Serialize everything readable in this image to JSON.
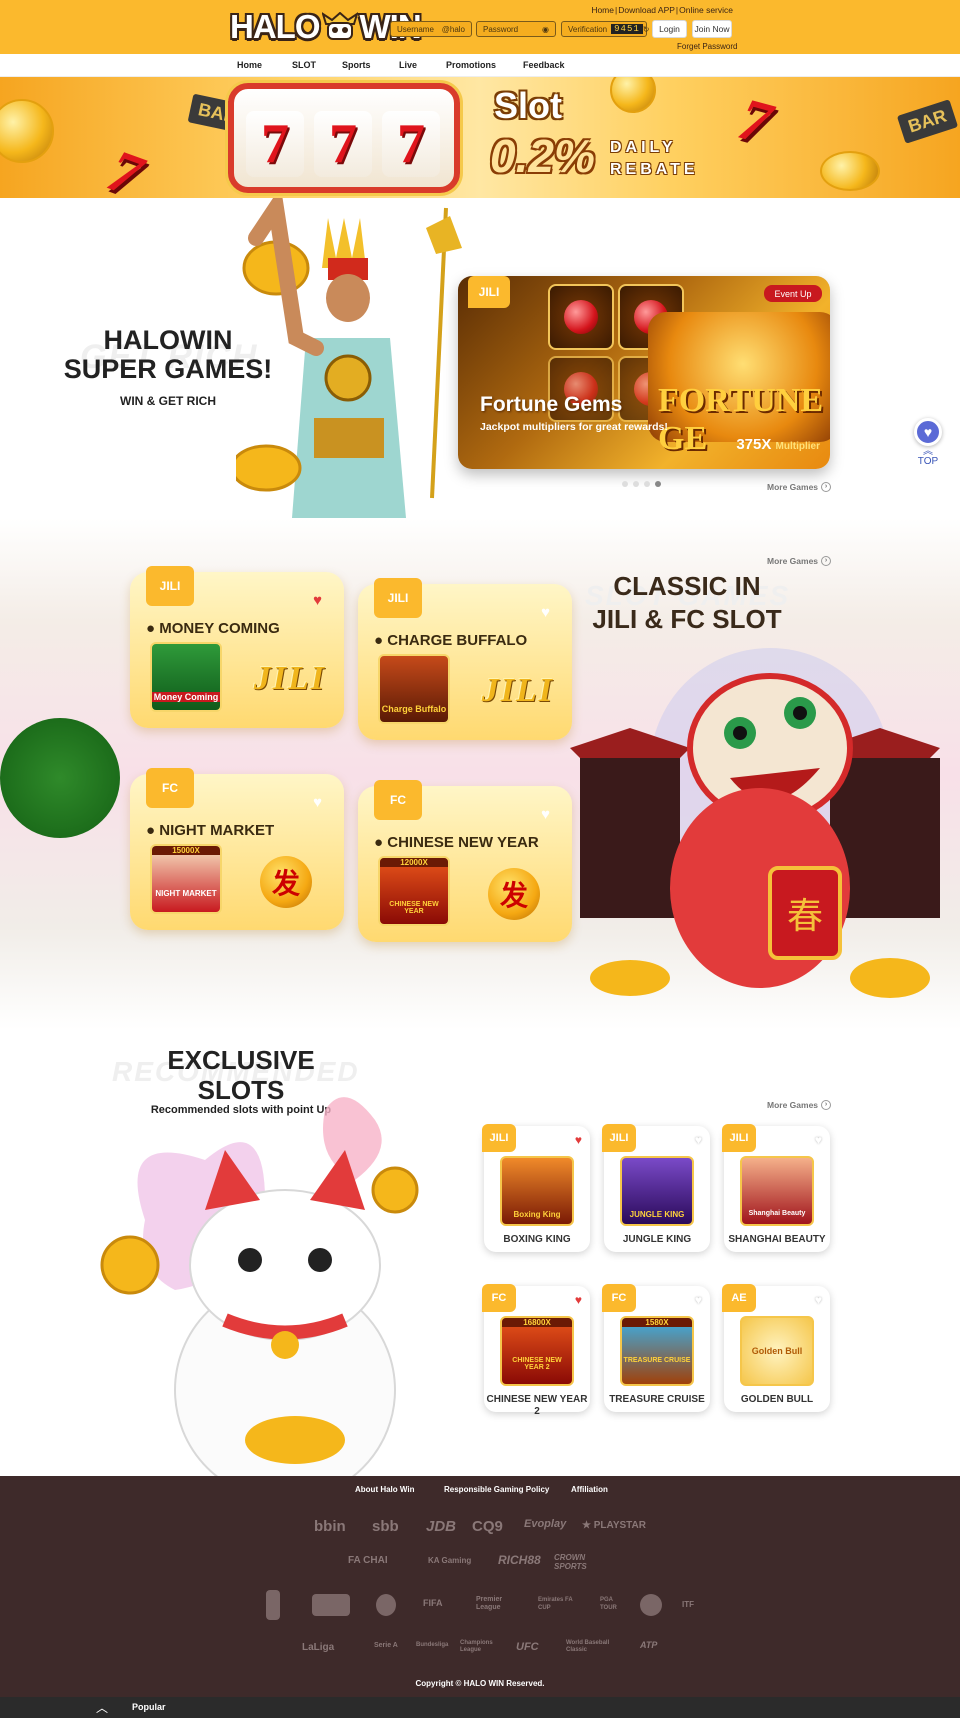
{
  "header": {
    "logo_left": "HALO",
    "logo_right": "WIN",
    "links": [
      "Home",
      "Download APP",
      "Online service"
    ],
    "username_placeholder": "Username",
    "username_suffix": "@halo",
    "password_placeholder": "Password",
    "verification_label": "Verification",
    "verification_code": "9451",
    "login_label": "Login",
    "join_label": "Join Now",
    "forget_password": "Forget Password"
  },
  "nav": [
    "Home",
    "SLOT",
    "Sports",
    "Live",
    "Promotions",
    "Feedback"
  ],
  "promo": {
    "title": "Slot",
    "rate": "0.2%",
    "line1": "DAILY",
    "line2": "REBATE",
    "reel_symbol": "7",
    "bar_text": "BAR"
  },
  "hero": {
    "title_line1": "HALOWIN",
    "title_line2": "SUPER GAMES!",
    "subtitle": "WIN & GET RICH",
    "ghost_text": "GET RICH",
    "feature": {
      "provider": "JILI",
      "badge": "Event Up",
      "title": "Fortune Gems",
      "subtitle": "Jackpot multipliers for great rewards!",
      "multiplier": "375X",
      "multiplier_label": "Multiplier",
      "art_text": "FORTUNE GE"
    },
    "more_games": "More Games"
  },
  "classic": {
    "more_games": "More Games",
    "title_line1": "CLASSIC IN",
    "title_line2": "JILI & FC SLOT",
    "ghost_text": "SLOT GAMES",
    "cards": [
      {
        "provider": "JILI",
        "name": "MONEY COMING",
        "favorite": true,
        "thumb_text": "Money Coming",
        "brand": "JILI"
      },
      {
        "provider": "JILI",
        "name": "CHARGE BUFFALO",
        "favorite": false,
        "thumb_text": "Charge Buffalo",
        "brand": "JILI"
      },
      {
        "provider": "FC",
        "name": "NIGHT MARKET",
        "favorite": false,
        "thumb_text": "NIGHT MARKET",
        "brand": "发",
        "badge": "15000X"
      },
      {
        "provider": "FC",
        "name": "CHINESE NEW YEAR",
        "favorite": false,
        "thumb_text": "CHINESE NEW YEAR",
        "brand": "发",
        "badge": "12000X"
      }
    ],
    "lantern_char": "春"
  },
  "exclusive": {
    "title_line1": "EXCLUSIVE",
    "title_line2": "SLOTS",
    "subtitle": "Recommended slots with point Up",
    "ghost_text": "RECOMMENDED",
    "more_games": "More Games",
    "cards": [
      {
        "provider": "JILI",
        "name": "BOXING KING",
        "favorite": true,
        "thumb_text": "Boxing King"
      },
      {
        "provider": "JILI",
        "name": "JUNGLE KING",
        "favorite": false,
        "thumb_text": "JUNGLE KING"
      },
      {
        "provider": "JILI",
        "name": "SHANGHAI BEAUTY",
        "favorite": false,
        "thumb_text": "Shanghai Beauty"
      },
      {
        "provider": "FC",
        "name": "CHINESE NEW YEAR 2",
        "favorite": true,
        "thumb_text": "CHINESE NEW YEAR 2",
        "badge": "16800X"
      },
      {
        "provider": "FC",
        "name": "TREASURE CRUISE",
        "favorite": false,
        "thumb_text": "TREASURE CRUISE",
        "badge": "1580X"
      },
      {
        "provider": "AE",
        "name": "GOLDEN BULL",
        "favorite": false,
        "thumb_text": "Golden Bull"
      }
    ]
  },
  "side": {
    "top_label": "TOP"
  },
  "footer": {
    "links": [
      "About Halo Win",
      "Responsible Gaming Policy",
      "Affiliation"
    ],
    "providers_row1": [
      "bbin",
      "sbb",
      "JDB",
      "CQ9",
      "Evoplay",
      "PLAYSTAR"
    ],
    "providers_row2": [
      "FA CHAI",
      "KA Gaming",
      "RICH88",
      "CROWN SPORTS"
    ],
    "leagues_row1": [
      "NBA",
      "MLB",
      "NHL",
      "FIFA",
      "Premier League",
      "Emirates FA CUP",
      "PGA TOUR",
      "UEFA",
      "ITF"
    ],
    "leagues_row2": [
      "LaLiga",
      "Serie A",
      "Bundesliga",
      "Champions League",
      "UFC",
      "World Baseball Classic",
      "ATP"
    ],
    "copyright": "Copyright © HALO WIN Reserved."
  },
  "bottombar": {
    "popular": "Popular"
  },
  "colors": {
    "brand_yellow": "#fbb92d",
    "footer_bg": "#3e2a2a",
    "heart_red": "#e23b3b"
  }
}
